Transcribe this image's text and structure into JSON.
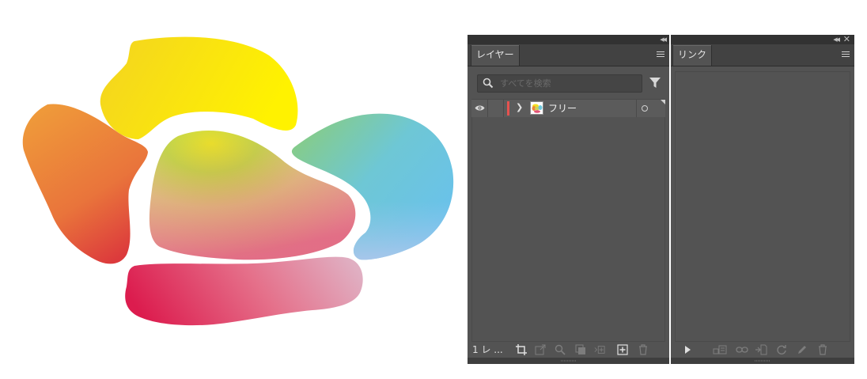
{
  "artwork": {
    "shapes": [
      "yellow-blob",
      "orange-blob",
      "green-blob",
      "blue-blob",
      "pink-blob"
    ]
  },
  "layers_panel": {
    "tab_label": "レイヤー",
    "search_placeholder": "すべてを検索",
    "layers": [
      {
        "name": "フリー",
        "visible": true,
        "color": "#e5524f"
      }
    ],
    "footer_count": "1 レ ...",
    "footer_icons": [
      "artboard-clip-icon",
      "export-icon",
      "locate-object-icon",
      "clipping-mask-icon",
      "new-sublayer-icon",
      "new-layer-icon",
      "trash-icon"
    ]
  },
  "links_panel": {
    "tab_label": "リンク",
    "footer_icons": [
      "show-info-icon",
      "relink-library-icon",
      "relink-icon",
      "go-to-link-icon",
      "update-link-icon",
      "edit-original-icon",
      "delete-link-icon"
    ]
  },
  "colors": {
    "panel_bg": "#535353",
    "title_bar": "#323232",
    "layer_color": "#e5524f"
  }
}
